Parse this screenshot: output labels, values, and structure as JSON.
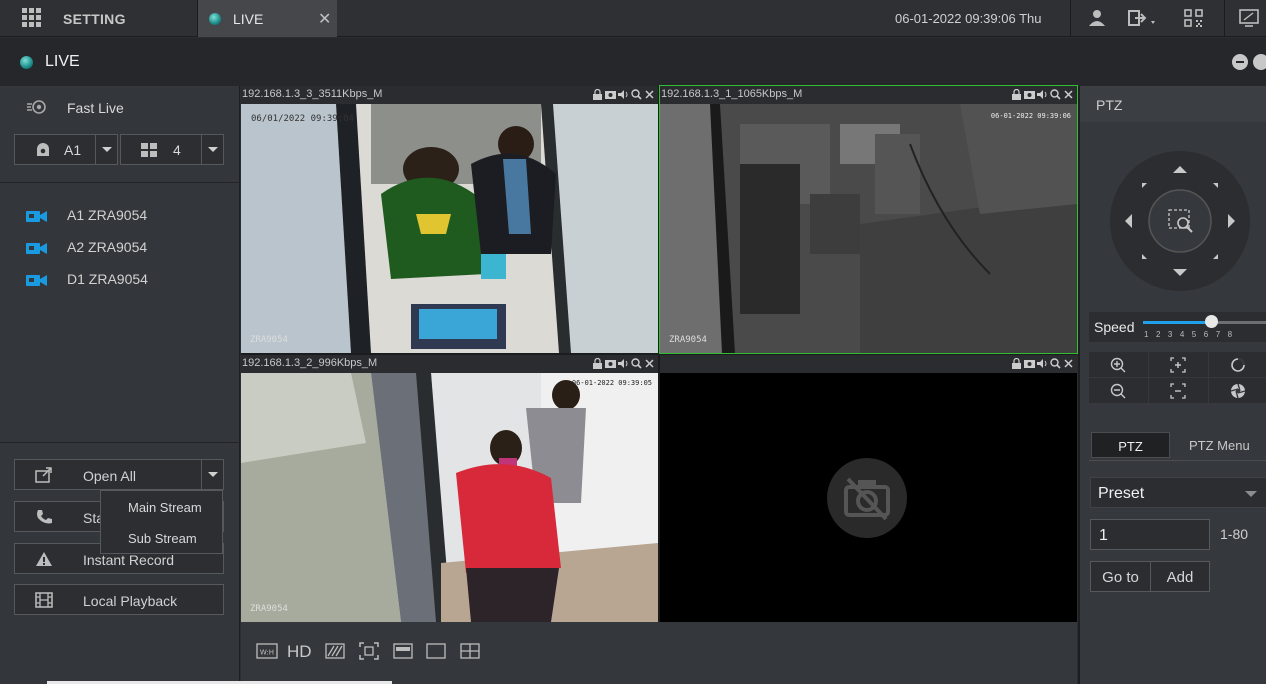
{
  "topbar": {
    "setting_label": "SETTING",
    "live_tab_label": "LIVE",
    "close_glyph": "✕",
    "datetime": "06-01-2022 09:39:06 Thu"
  },
  "window": {
    "title": "LIVE"
  },
  "left": {
    "fast_live": "Fast Live",
    "channel_select": "A1",
    "layout_select": "4",
    "cameras": [
      {
        "label": "A1 ZRA9054"
      },
      {
        "label": "A2 ZRA9054"
      },
      {
        "label": "D1 ZRA9054"
      }
    ],
    "open_all": "Open All",
    "stream_menu": [
      "Main Stream",
      "Sub Stream"
    ],
    "start_talk": "Sta",
    "instant_record": "Instant Record",
    "local_playback": "Local Playback"
  },
  "views": [
    {
      "title": "192.168.1.3_3_3511Kbps_M",
      "stamp": "06/01/2022 09:39:04",
      "name": "ZRA9054"
    },
    {
      "title": "192.168.1.3_1_1065Kbps_M",
      "stamp": "06-01-2022 09:39:06",
      "name": "ZRA9054"
    },
    {
      "title": "192.168.1.3_2_996Kbps_M",
      "stamp": "06-01-2022 09:39:05",
      "name": "ZRA9054"
    },
    {
      "title": "",
      "stamp": "",
      "name": ""
    }
  ],
  "bottom": {
    "hd_label": "HD"
  },
  "ptz": {
    "header": "PTZ",
    "speed_label": "Speed",
    "speed_value": 5,
    "speed_max": 8,
    "speed_ticks": "12345678",
    "tab_ptz": "PTZ",
    "tab_menu": "PTZ Menu",
    "preset_label": "Preset",
    "preset_number": "1",
    "preset_range": "1-80",
    "goto_label": "Go to",
    "add_label": "Add"
  },
  "colors": {
    "accent": "#1fa0e8",
    "active_border": "#2fbf2f",
    "camera_icon": "#1a9ae0"
  }
}
